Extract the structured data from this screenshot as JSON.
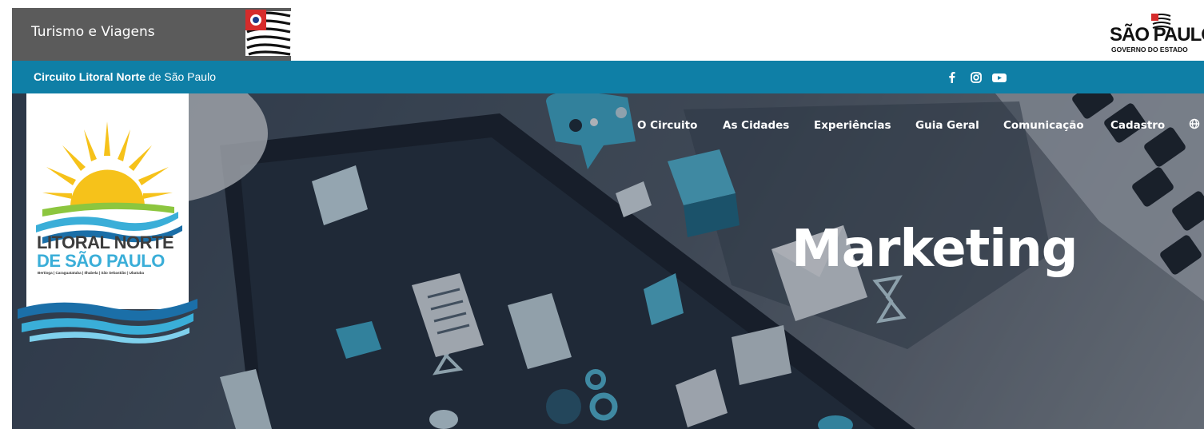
{
  "header": {
    "gov_title": "Turismo e Viagens",
    "sp_logo_main": "SÃO PAULO",
    "sp_logo_sub": "GOVERNO DO ESTADO"
  },
  "bluebar": {
    "circuit_bold": "Circuito Litoral Norte",
    "circuit_rest": " de São Paulo",
    "social": [
      "facebook-icon",
      "instagram-icon",
      "youtube-icon"
    ]
  },
  "nav": {
    "items": [
      "O Circuito",
      "As Cidades",
      "Experiências",
      "Guia Geral",
      "Comunicação",
      "Cadastro"
    ],
    "language_icon": "globe-icon"
  },
  "hero": {
    "title": "Marketing"
  },
  "logo": {
    "line1": "LITORAL NORTE",
    "line2": "DE SÃO PAULO",
    "line3": "Bertioga | Caraguatatuba | Ilhabela | São Sebastião | Ubatuba"
  },
  "colors": {
    "blue_bar": "#0f7fa6",
    "gov_bar": "#5b5b5b",
    "logo_sun": "#f6c21a",
    "logo_wave": "#3aaed8"
  }
}
